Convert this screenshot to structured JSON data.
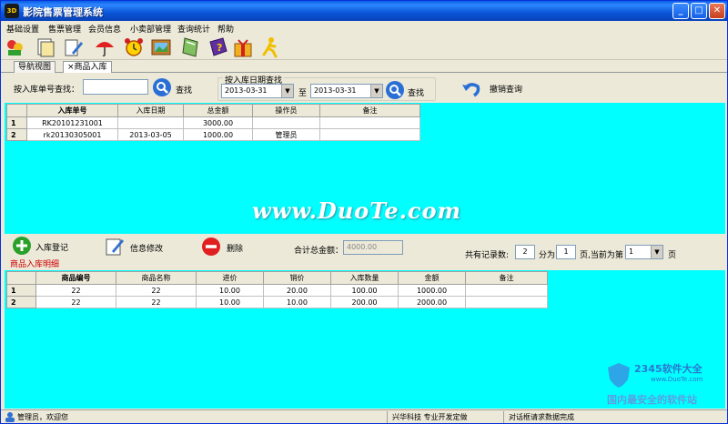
{
  "window": {
    "title": "影院售票管理系统",
    "app_icon_text": "3D"
  },
  "menu": [
    "基础设置",
    "售票管理",
    "会员信息",
    "小卖部管理",
    "查询统计",
    "帮助"
  ],
  "toolbar_icons": [
    "flowers-icon",
    "document-stack-icon",
    "edit-document-icon",
    "umbrella-icon",
    "alarm-clock-icon",
    "picture-icon",
    "book-icon",
    "help-book-icon",
    "gift-icon",
    "runner-icon"
  ],
  "tabs": [
    "导航视图",
    "商品入库"
  ],
  "search": {
    "label_no": "按入库单号查找：",
    "no_value": "",
    "find_btn": "查找",
    "date_group": "按入库日期查找",
    "date_from": "2013-03-31",
    "to_label": "至",
    "date_to": "2013-03-31",
    "find_btn2": "查找",
    "cancel_btn": "撤销查询"
  },
  "grid1": {
    "columns": [
      "入库单号",
      "入库日期",
      "总金额",
      "操作员",
      "备注"
    ],
    "rows": [
      {
        "num": "1",
        "cells": [
          "RK20101231001",
          "",
          "3000.00",
          "",
          ""
        ]
      },
      {
        "num": "2",
        "cells": [
          "rk20130305001",
          "2013-03-05",
          "1000.00",
          "管理员",
          ""
        ]
      }
    ]
  },
  "watermark": "www.DuoTe.com",
  "actions": {
    "add": "入库登记",
    "edit": "信息修改",
    "delete": "删除",
    "total_label": "合计总金额：",
    "total_value": "4000.00",
    "detail_label": "商品入库明细",
    "records_label": "共有记录数:",
    "records_value": "2",
    "pages_label": "分为",
    "pages_value": "1",
    "current_label": "页,当前为第",
    "current_value": "1",
    "page_unit": "页"
  },
  "grid2": {
    "columns": [
      "商品编号",
      "商品名称",
      "进价",
      "销价",
      "入库数量",
      "金额",
      "备注"
    ],
    "rows": [
      {
        "num": "1",
        "cells": [
          "22",
          "22",
          "10.00",
          "20.00",
          "100.00",
          "1000.00",
          ""
        ]
      },
      {
        "num": "2",
        "cells": [
          "22",
          "22",
          "10.00",
          "10.00",
          "200.00",
          "2000.00",
          ""
        ]
      }
    ]
  },
  "status": {
    "user": "管理员，欢迎您",
    "company": "兴华科技 专业开发定做",
    "message": "对话框请求数据完成"
  },
  "logo": {
    "brand": "2345软件大全",
    "url": "www.DuoTe.com",
    "slogan": "国内最安全的软件站"
  },
  "colors": {
    "grid_bg": "#00ffff",
    "titlebar": "#0a55d8",
    "accent_red": "#cc0000"
  }
}
